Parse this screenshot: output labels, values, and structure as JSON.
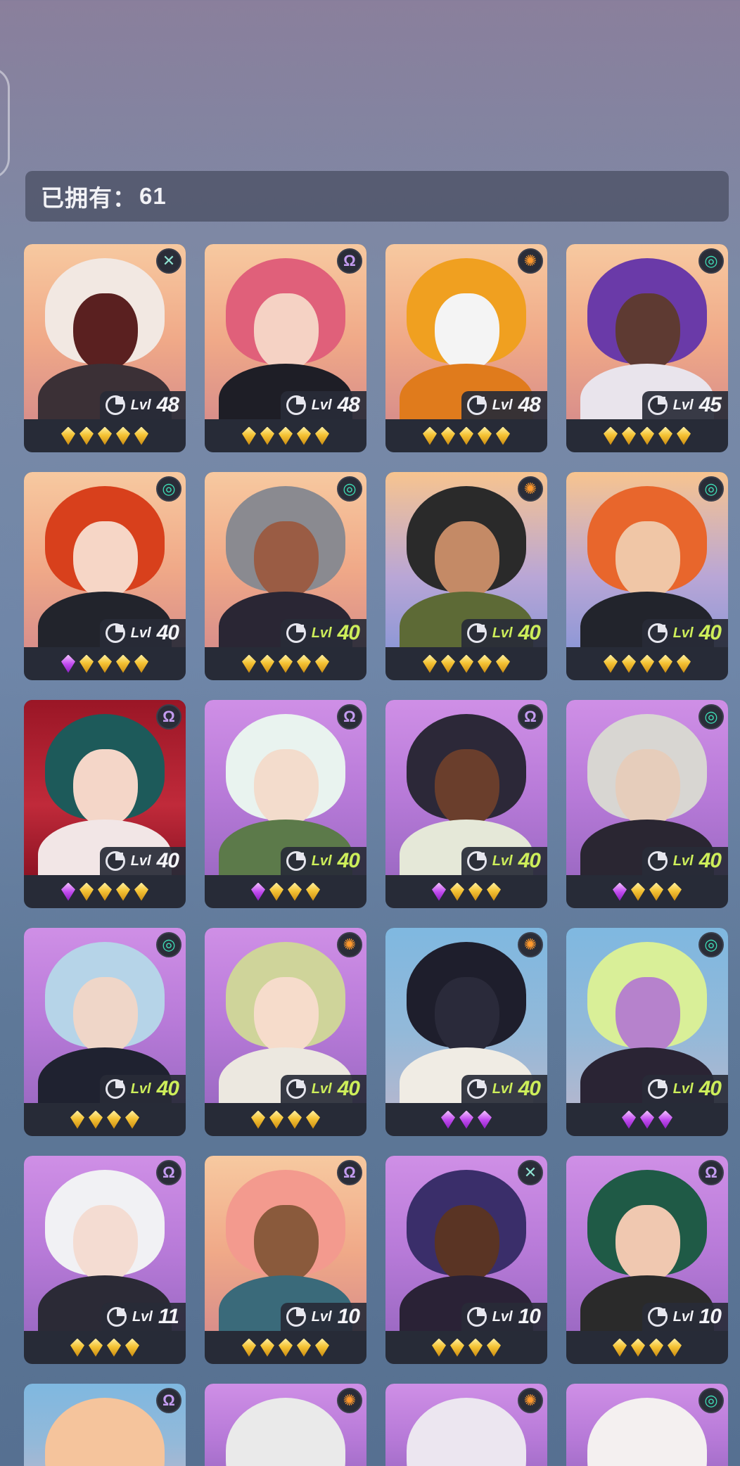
{
  "header": {
    "owned_label": "已拥有：",
    "owned_count": "61"
  },
  "lvl_prefix": "Lvl",
  "element_glyphs": {
    "cross": "✕",
    "omega": "Ω",
    "sun": "✺",
    "swirl": "◎"
  },
  "heroes": [
    {
      "element": "cross",
      "level": "48",
      "lvl_color": "white",
      "gems": [
        "gold",
        "gold",
        "gold",
        "gold",
        "gold"
      ],
      "bg": "warm",
      "hair": "#f2e8e2",
      "skin": "#5a2020",
      "body": "#3b3036"
    },
    {
      "element": "omega",
      "level": "48",
      "lvl_color": "white",
      "gems": [
        "gold",
        "gold",
        "gold",
        "gold",
        "gold"
      ],
      "bg": "warm",
      "hair": "#e0607a",
      "skin": "#f5d2c4",
      "body": "#1e1e26"
    },
    {
      "element": "sun",
      "level": "48",
      "lvl_color": "white",
      "gems": [
        "gold",
        "gold",
        "gold",
        "gold",
        "gold"
      ],
      "bg": "warm",
      "hair": "#f0a020",
      "skin": "#f4f4f4",
      "body": "#e07b1c"
    },
    {
      "element": "swirl",
      "level": "45",
      "lvl_color": "white",
      "gems": [
        "gold",
        "gold",
        "gold",
        "gold",
        "gold"
      ],
      "bg": "warm",
      "hair": "#6a3aa8",
      "skin": "#5e3a32",
      "body": "#e9e4ec"
    },
    {
      "element": "swirl",
      "level": "40",
      "lvl_color": "white",
      "gems": [
        "purple",
        "gold",
        "gold",
        "gold",
        "gold"
      ],
      "bg": "warm",
      "hair": "#d8401c",
      "skin": "#f6d6c6",
      "body": "#22242c"
    },
    {
      "element": "swirl",
      "level": "40",
      "lvl_color": "green",
      "gems": [
        "gold",
        "gold",
        "gold",
        "gold",
        "gold"
      ],
      "bg": "warm",
      "hair": "#8a8a90",
      "skin": "#9a5c44",
      "body": "#2a2634"
    },
    {
      "element": "sun",
      "level": "40",
      "lvl_color": "green",
      "gems": [
        "gold",
        "gold",
        "gold",
        "gold",
        "gold"
      ],
      "bg": "dusk",
      "hair": "#2a2a2a",
      "skin": "#c48a66",
      "body": "#5d6a36"
    },
    {
      "element": "swirl",
      "level": "40",
      "lvl_color": "green",
      "gems": [
        "gold",
        "gold",
        "gold",
        "gold",
        "gold"
      ],
      "bg": "dusk",
      "hair": "#e8662c",
      "skin": "#f0c6a6",
      "body": "#22242c"
    },
    {
      "element": "omega",
      "level": "40",
      "lvl_color": "white",
      "gems": [
        "purple",
        "gold",
        "gold",
        "gold",
        "gold"
      ],
      "bg": "red",
      "hair": "#1d5a5a",
      "skin": "#f4d6c8",
      "body": "#f2e6e6"
    },
    {
      "element": "omega",
      "level": "40",
      "lvl_color": "green",
      "gems": [
        "purple",
        "gold",
        "gold",
        "gold"
      ],
      "bg": "purple",
      "hair": "#e9f3ef",
      "skin": "#f3dccc",
      "body": "#5c7a4a"
    },
    {
      "element": "omega",
      "level": "40",
      "lvl_color": "green",
      "gems": [
        "purple",
        "gold",
        "gold",
        "gold"
      ],
      "bg": "purple",
      "hair": "#2c2838",
      "skin": "#6a3e2c",
      "body": "#e5e8d8"
    },
    {
      "element": "swirl",
      "level": "40",
      "lvl_color": "green",
      "gems": [
        "purple",
        "gold",
        "gold",
        "gold"
      ],
      "bg": "purple",
      "hair": "#d8d6d2",
      "skin": "#e6cdbb",
      "body": "#2a2632"
    },
    {
      "element": "swirl",
      "level": "40",
      "lvl_color": "green",
      "gems": [
        "gold",
        "gold",
        "gold",
        "gold"
      ],
      "bg": "purple",
      "hair": "#b6d4e8",
      "skin": "#efd6c8",
      "body": "#1f2230"
    },
    {
      "element": "sun",
      "level": "40",
      "lvl_color": "green",
      "gems": [
        "gold",
        "gold",
        "gold",
        "gold"
      ],
      "bg": "purple",
      "hair": "#cfd49a",
      "skin": "#f6dccb",
      "body": "#ece8e0"
    },
    {
      "element": "sun",
      "level": "40",
      "lvl_color": "green",
      "gems": [
        "purple",
        "purple",
        "purple"
      ],
      "bg": "sky",
      "hair": "#1e1e2c",
      "skin": "#2a2a3a",
      "body": "#f0ece4"
    },
    {
      "element": "swirl",
      "level": "40",
      "lvl_color": "green",
      "gems": [
        "purple",
        "purple",
        "purple"
      ],
      "bg": "sky",
      "hair": "#d9ef98",
      "skin": "#b682cc",
      "body": "#2a2434"
    },
    {
      "element": "omega",
      "level": "11",
      "lvl_color": "white",
      "gems": [
        "gold",
        "gold",
        "gold",
        "gold"
      ],
      "bg": "purple",
      "hair": "#f1f1f4",
      "skin": "#f4dcd2",
      "body": "#2b2a36"
    },
    {
      "element": "omega",
      "level": "10",
      "lvl_color": "white",
      "gems": [
        "gold",
        "gold",
        "gold",
        "gold",
        "gold"
      ],
      "bg": "warm",
      "hair": "#f39a8e",
      "skin": "#8a5a3c",
      "body": "#3a6a7a"
    },
    {
      "element": "cross",
      "level": "10",
      "lvl_color": "white",
      "gems": [
        "gold",
        "gold",
        "gold",
        "gold"
      ],
      "bg": "purple",
      "hair": "#3a2e6a",
      "skin": "#5a3424",
      "body": "#2a2236"
    },
    {
      "element": "omega",
      "level": "10",
      "lvl_color": "white",
      "gems": [
        "gold",
        "gold",
        "gold",
        "gold"
      ],
      "bg": "purple",
      "hair": "#1f5a46",
      "skin": "#f0c8b0",
      "body": "#2a2a2a"
    }
  ],
  "partial_heroes": [
    {
      "element": "omega",
      "bg": "sky",
      "hair": "#f5c49c"
    },
    {
      "element": "sun",
      "bg": "purple",
      "hair": "#eaeaea"
    },
    {
      "element": "sun",
      "bg": "purple",
      "hair": "#ece6f0"
    },
    {
      "element": "swirl",
      "bg": "purple",
      "hair": "#f4f0f0"
    }
  ]
}
